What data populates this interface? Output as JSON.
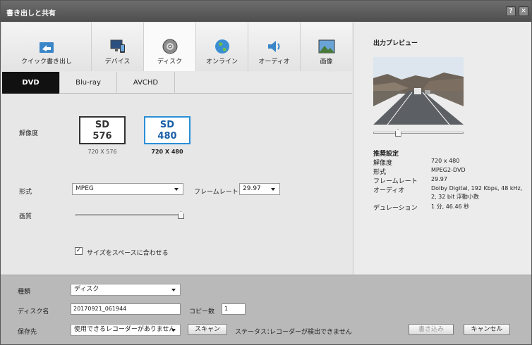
{
  "window": {
    "title": "書き出しと共有",
    "help_label": "?",
    "close_label": "✕"
  },
  "categories": [
    {
      "label": "クイック書き出し",
      "icon": "quick-export-icon"
    },
    {
      "label": "デバイス",
      "icon": "device-icon"
    },
    {
      "label": "ディスク",
      "icon": "disc-icon"
    },
    {
      "label": "オンライン",
      "icon": "globe-icon"
    },
    {
      "label": "オーディオ",
      "icon": "speaker-icon"
    },
    {
      "label": "画像",
      "icon": "image-icon"
    }
  ],
  "subtabs": [
    "DVD",
    "Blu-ray",
    "AVCHD"
  ],
  "settings": {
    "resolution_label": "解像度",
    "sd576": {
      "line1": "SD",
      "line2": "576",
      "caption": "720 X 576"
    },
    "sd480": {
      "line1": "SD",
      "line2": "480",
      "caption": "720 X 480"
    },
    "format_label": "形式",
    "format_value": "MPEG",
    "framerate_label": "フレームレート",
    "framerate_value": "29.97",
    "quality_label": "画質",
    "quality_level": 1.0,
    "fit_label": "サイズをスペースに合わせる",
    "fit_checked": true,
    "check_mark": "✓"
  },
  "preview": {
    "title": "出力プレビュー",
    "position": 0.27,
    "recommended_title": "推奨設定",
    "rows": [
      {
        "k": "解像度",
        "v": "720 x 480"
      },
      {
        "k": "形式",
        "v": "MPEG2-DVD"
      },
      {
        "k": "フレームレート",
        "v": "29.97"
      },
      {
        "k": "オーディオ",
        "v": "Dolby Digital, 192 Kbps, 48 kHz,"
      },
      {
        "k": "",
        "v": "2, 32 bit 浮動小数"
      },
      {
        "k": "デュレーション",
        "v": "1 分, 46.46 秒"
      }
    ]
  },
  "bottom": {
    "type_label": "種類",
    "type_value": "ディスク",
    "disc_name_label": "ディスク名",
    "disc_name_value": "20170921_061944",
    "copies_label": "コピー数",
    "copies_value": "1",
    "save_to_label": "保存先",
    "save_to_value": "使用できるレコーダーがありません",
    "scan_label": "スキャン",
    "status_label": "ステータス：",
    "status_value": "レコーダーが検出できません",
    "write_label": "書き込み",
    "cancel_label": "キャンセル"
  },
  "colors": {
    "selected_blue": "#2a8fd8",
    "sd480_text": "#1a5fa8"
  }
}
